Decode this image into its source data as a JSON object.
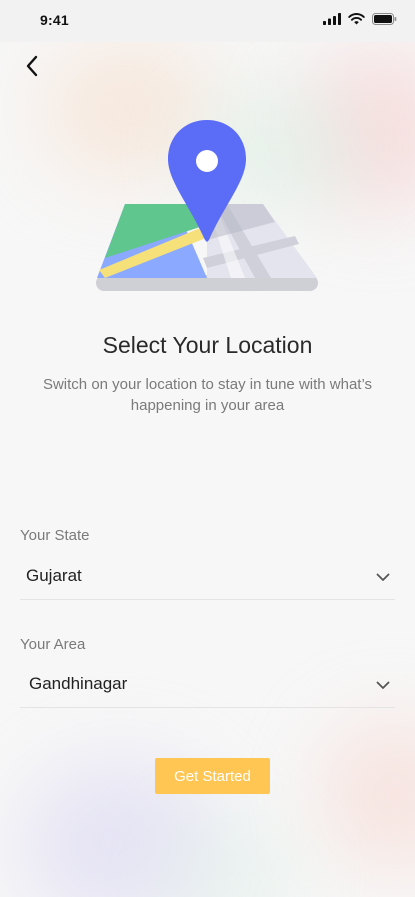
{
  "status_bar": {
    "time": "9:41",
    "icons": [
      "cellular-signal-icon",
      "wifi-icon",
      "battery-icon"
    ]
  },
  "header": {
    "back_icon": "chevron-left-icon"
  },
  "illustration": {
    "icon": "map-location-pin-icon",
    "colors": {
      "pin": "#5b6cf7",
      "map_green": "#5fc68d",
      "map_yellow": "#f5e07a",
      "map_blue": "#8aa9ff",
      "map_base": "#cfcfd6"
    }
  },
  "content": {
    "title": "Select Your Location",
    "subtitle": "Switch on your location to stay in tune with what’s happening in your area"
  },
  "form": {
    "state": {
      "label": "Your State",
      "value": "Gujarat",
      "icon": "chevron-down-icon"
    },
    "area": {
      "label": "Your Area",
      "value": "Gandhinagar",
      "icon": "chevron-down-icon"
    }
  },
  "actions": {
    "get_started_label": "Get Started",
    "accent_color": "#ffc654"
  }
}
